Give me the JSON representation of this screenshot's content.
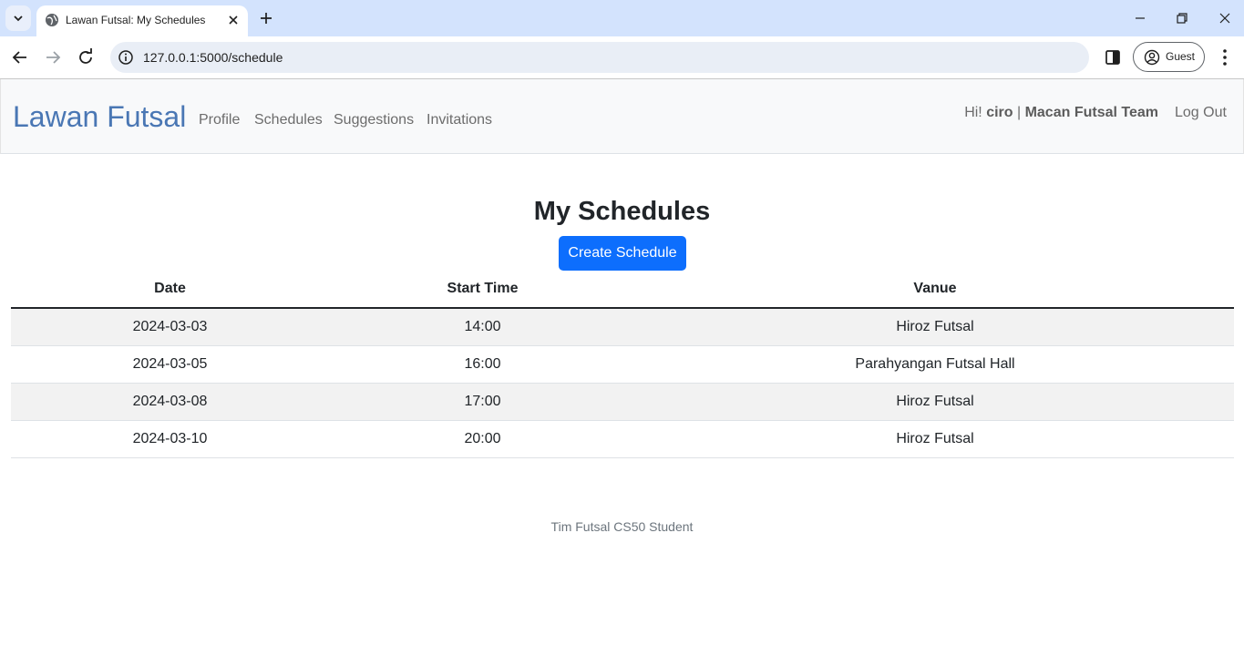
{
  "browser": {
    "tab_title": "Lawan Futsal: My Schedules",
    "url": "127.0.0.1:5000/schedule",
    "profile_label": "Guest"
  },
  "navbar": {
    "brand": "Lawan Futsal",
    "links": [
      "Profile",
      "Schedules",
      "Suggestions",
      "Invitations"
    ],
    "greeting_prefix": "Hi! ",
    "username": "ciro",
    "separator": " | ",
    "team": "Macan Futsal Team",
    "logout": "Log Out"
  },
  "main": {
    "title": "My Schedules",
    "create_button": "Create Schedule",
    "table": {
      "headers": [
        "Date",
        "Start Time",
        "Vanue"
      ],
      "rows": [
        [
          "2024-03-03",
          "14:00",
          "Hiroz Futsal"
        ],
        [
          "2024-03-05",
          "16:00",
          "Parahyangan Futsal Hall"
        ],
        [
          "2024-03-08",
          "17:00",
          "Hiroz Futsal"
        ],
        [
          "2024-03-10",
          "20:00",
          "Hiroz Futsal"
        ]
      ]
    }
  },
  "footer": {
    "text": "Tim Futsal CS50 Student"
  },
  "colors": {
    "brand": "#4a77b4",
    "primary_button": "#0d6efd",
    "tabstrip": "#d3e3fd"
  }
}
